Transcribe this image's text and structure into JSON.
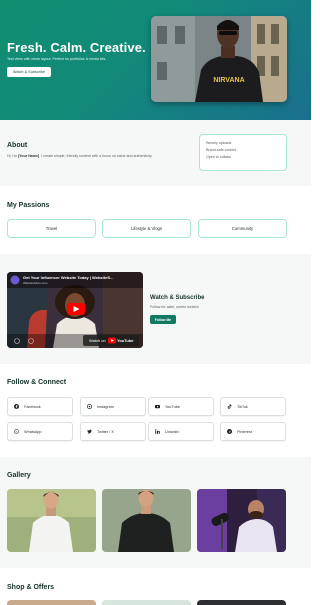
{
  "hero": {
    "title": "Fresh. Calm. Creative.",
    "subtitle": "Teal vibes with clean layout. Perfect for portfolios & media kits.",
    "cta_label": "Watch & Subscribe",
    "photo_shirt_text": "NIRVANA"
  },
  "about": {
    "heading": "About",
    "text_prefix": "Hi, I'm ",
    "text_name": "[Your Name]",
    "text_suffix": ". I create simple, friendly content with a focus on value and authenticity.",
    "facts": [
      "Weekly uploads",
      "Brand-safe content",
      "Open to collabs"
    ]
  },
  "passions": {
    "heading": "My Passions",
    "items": [
      "Travel",
      "Lifestyle & Vlogs",
      "Community"
    ]
  },
  "video": {
    "thumb_title": "Get Your Influencer Website Today | WebsiteS...",
    "thumb_channel": "WebsiteStore.com",
    "watch_on": "Watch on",
    "youtube_word": "YouTube",
    "heading": "Watch & Subscribe",
    "subtext": "Follow for calm, useful content.",
    "button": "Follow Me"
  },
  "follow": {
    "heading": "Follow & Connect",
    "links": [
      {
        "label": "Facebook",
        "icon": "facebook-icon"
      },
      {
        "label": "Instagram",
        "icon": "instagram-icon"
      },
      {
        "label": "YouTube",
        "icon": "youtube-icon"
      },
      {
        "label": "TikTok",
        "icon": "tiktok-icon"
      },
      {
        "label": "WhatsApp",
        "icon": "whatsapp-icon"
      },
      {
        "label": "Twitter / X",
        "icon": "twitter-icon"
      },
      {
        "label": "LinkedIn",
        "icon": "linkedin-icon"
      },
      {
        "label": "Pinterest",
        "icon": "pinterest-icon"
      }
    ]
  },
  "gallery": {
    "heading": "Gallery"
  },
  "shop": {
    "heading": "Shop & Offers"
  },
  "colors": {
    "accent": "#127a63",
    "hero_start": "#0f8f70",
    "hero_end": "#1a6f8e",
    "card_border": "#a8e6d3",
    "youtube_red": "#ff0000"
  }
}
